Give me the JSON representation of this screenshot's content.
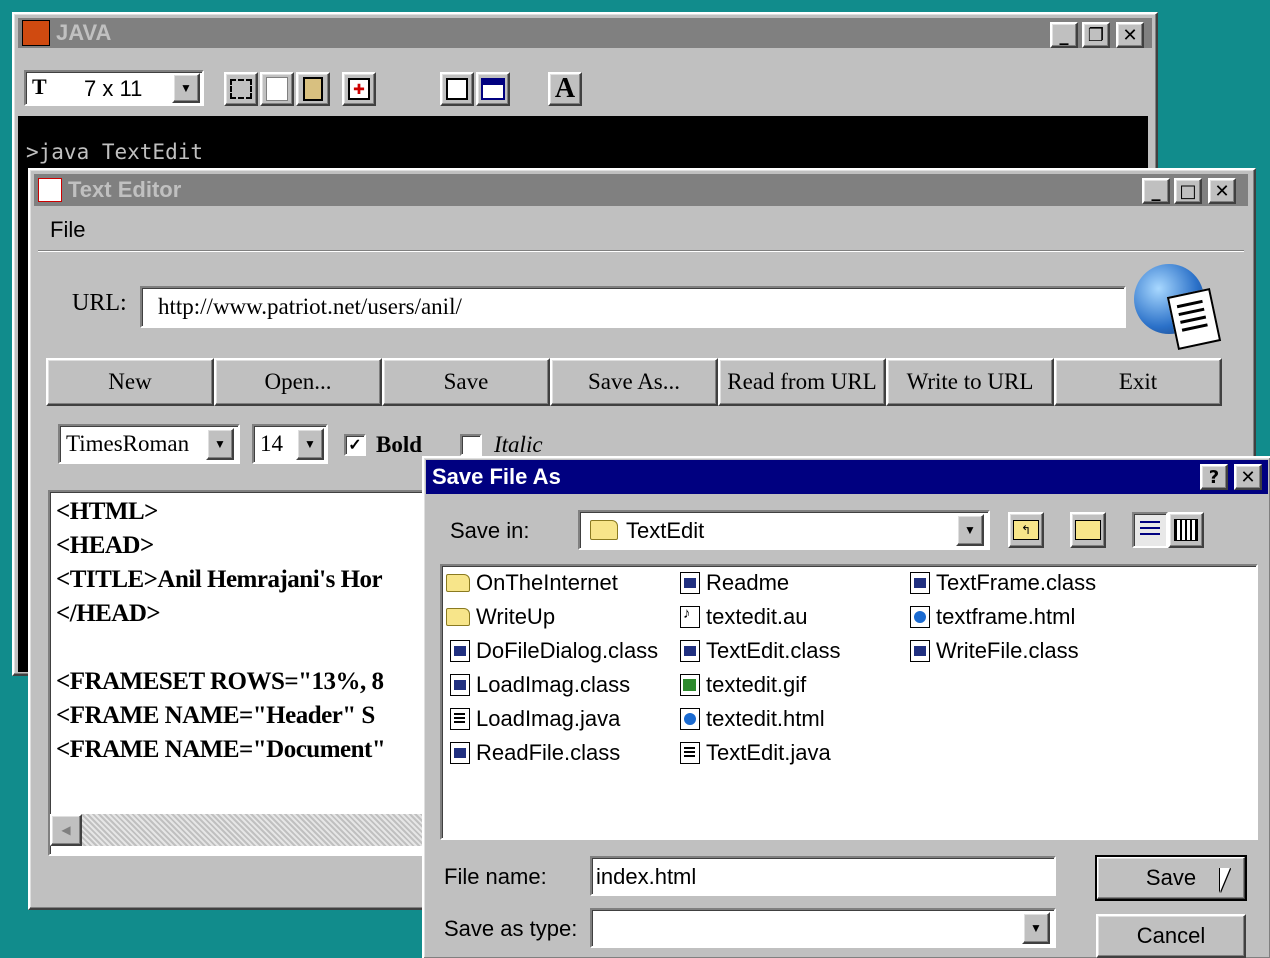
{
  "java_window": {
    "title": "JAVA",
    "font_size_value": "7 x 11",
    "console_line": ">java TextEdit"
  },
  "text_editor": {
    "title": "Text Editor",
    "menu": [
      "File"
    ],
    "url_label": "URL:",
    "url_value": "http://www.patriot.net/users/anil/",
    "buttons": [
      "New",
      "Open...",
      "Save",
      "Save As...",
      "Read from URL",
      "Write to URL",
      "Exit"
    ],
    "font_family": "TimesRoman",
    "font_size": "14",
    "bold_label": "Bold",
    "bold_checked": true,
    "italic_label": "Italic",
    "italic_checked": false,
    "code_lines": [
      "<HTML>",
      "<HEAD>",
      "<TITLE>Anil Hemrajani's Hor",
      "</HEAD>",
      "",
      "<FRAMESET ROWS=\"13%, 8",
      "<FRAME NAME=\"Header\"   S",
      "<FRAME NAME=\"Document\""
    ]
  },
  "save_dialog": {
    "title": "Save File As",
    "help_label": "?",
    "save_in_label": "Save in:",
    "save_in_value": "TextEdit",
    "files": [
      {
        "name": "OnTheInternet",
        "icon": "folder-icon"
      },
      {
        "name": "WriteUp",
        "icon": "folder-icon"
      },
      {
        "name": "DoFileDialog.class",
        "icon": "class-file-icon"
      },
      {
        "name": "LoadImag.class",
        "icon": "class-file-icon"
      },
      {
        "name": "LoadImag.java",
        "icon": "java-file-icon"
      },
      {
        "name": "ReadFile.class",
        "icon": "class-file-icon"
      },
      {
        "name": "Readme",
        "icon": "class-file-icon"
      },
      {
        "name": "textedit.au",
        "icon": "audio-file-icon"
      },
      {
        "name": "TextEdit.class",
        "icon": "class-file-icon"
      },
      {
        "name": "textedit.gif",
        "icon": "gif-file-icon"
      },
      {
        "name": "textedit.html",
        "icon": "html-file-icon"
      },
      {
        "name": "TextEdit.java",
        "icon": "java-file-icon"
      },
      {
        "name": "TextFrame.class",
        "icon": "class-file-icon"
      },
      {
        "name": "textframe.html",
        "icon": "html-file-icon"
      },
      {
        "name": "WriteFile.class",
        "icon": "class-file-icon"
      }
    ],
    "file_name_label": "File name:",
    "file_name_value": "index.html",
    "save_type_label": "Save as type:",
    "save_type_value": "",
    "save_button": "Save",
    "cancel_button": "Cancel"
  }
}
